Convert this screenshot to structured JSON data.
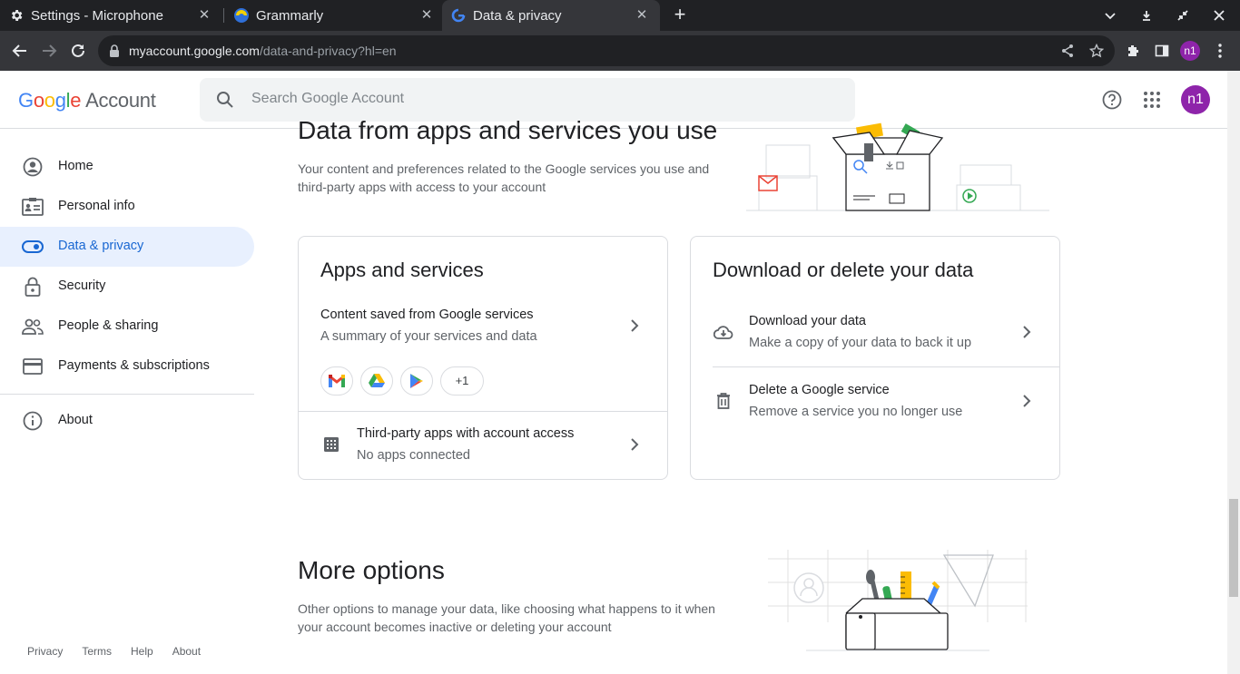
{
  "browser": {
    "tabs": [
      {
        "title": "Settings - Microphone",
        "icon": "gear-icon"
      },
      {
        "title": "Grammarly",
        "icon": "grammarly-icon"
      },
      {
        "title": "Data & privacy",
        "icon": "google-icon"
      }
    ],
    "url_host": "myaccount.google.com",
    "url_path": "/data-and-privacy?hl=en",
    "profile_initials": "n1"
  },
  "header": {
    "logo_google": "Google",
    "logo_account": "Account",
    "search_placeholder": "Search Google Account",
    "avatar_initials": "n1"
  },
  "sidebar": {
    "items": [
      {
        "label": "Home",
        "icon": "home-icon"
      },
      {
        "label": "Personal info",
        "icon": "id-card-icon"
      },
      {
        "label": "Data & privacy",
        "icon": "toggle-icon",
        "active": true
      },
      {
        "label": "Security",
        "icon": "lock-icon"
      },
      {
        "label": "People & sharing",
        "icon": "people-icon"
      },
      {
        "label": "Payments & subscriptions",
        "icon": "credit-card-icon"
      },
      {
        "label": "About",
        "icon": "info-icon"
      }
    ],
    "footer": [
      "Privacy",
      "Terms",
      "Help",
      "About"
    ]
  },
  "main": {
    "data_section": {
      "title": "Data from apps and services you use",
      "desc": "Your content and preferences related to the Google services you use and third-party apps with access to your account"
    },
    "apps_card": {
      "title": "Apps and services",
      "content_title": "Content saved from Google services",
      "content_sub": "A summary of your services and data",
      "more_apps": "+1",
      "third_title": "Third-party apps with account access",
      "third_sub": "No apps connected"
    },
    "download_card": {
      "title": "Download or delete your data",
      "download_title": "Download your data",
      "download_sub": "Make a copy of your data to back it up",
      "delete_title": "Delete a Google service",
      "delete_sub": "Remove a service you no longer use"
    },
    "more_section": {
      "title": "More options",
      "desc": "Other options to manage your data, like choosing what happens to it when your account becomes inactive or deleting your account"
    }
  },
  "colors": {
    "blue": "#4285f4",
    "red": "#ea4335",
    "yellow": "#fbbc04",
    "green": "#34a853",
    "active_bg": "#e8f0fe",
    "active_text": "#1967d2"
  }
}
